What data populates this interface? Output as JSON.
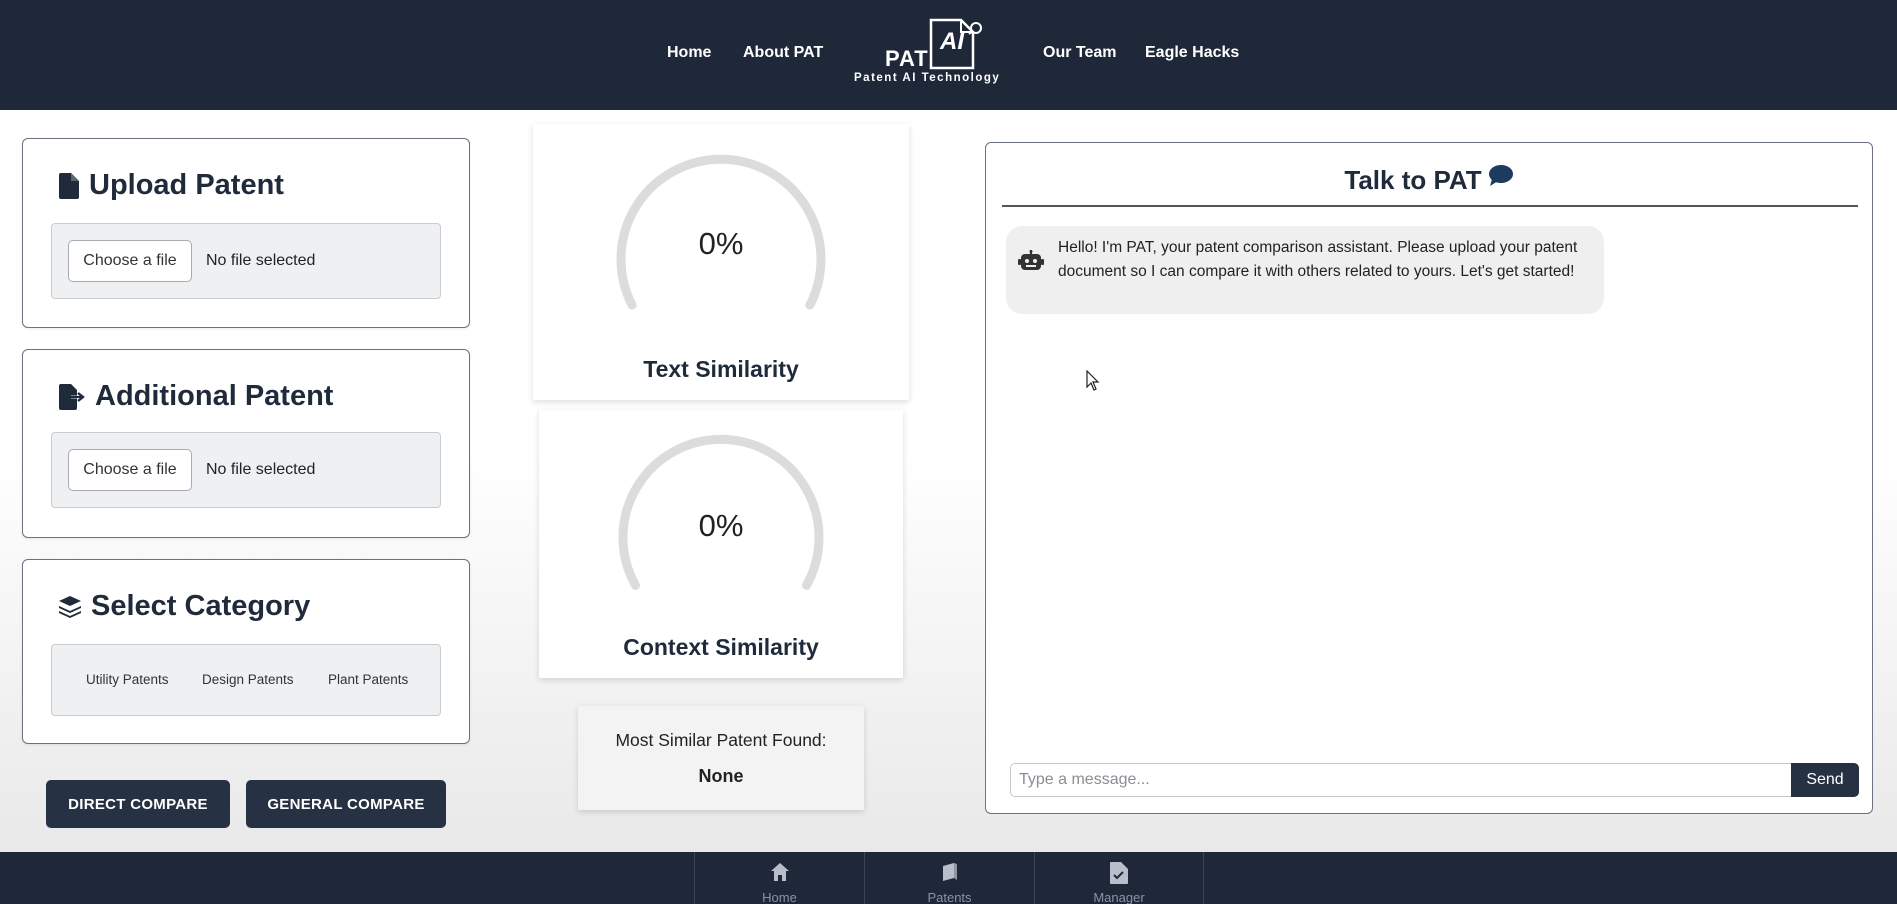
{
  "nav": {
    "links": [
      "Home",
      "About PAT",
      "Our Team",
      "Eagle Hacks"
    ],
    "logo_text": "PAT",
    "logo_badge": "AI",
    "logo_subtitle": "Patent AI Technology",
    "bg_color": "#1f2838"
  },
  "upload": {
    "title": "Upload Patent",
    "icon": "file-icon",
    "button_label": "Choose a file",
    "status": "No file selected"
  },
  "additional": {
    "title": "Additional Patent",
    "icon": "file-export-icon",
    "button_label": "Choose a file",
    "status": "No file selected"
  },
  "category": {
    "title": "Select Category",
    "icon": "layers-icon",
    "options": [
      "Utility Patents",
      "Design Patents",
      "Plant Patents"
    ]
  },
  "actions": {
    "direct": "DIRECT COMPARE",
    "general": "GENERAL COMPARE"
  },
  "gauges": {
    "text": {
      "value": "0%",
      "percent": 0,
      "label": "Text Similarity"
    },
    "context": {
      "value": "0%",
      "percent": 0,
      "label": "Context Similarity"
    }
  },
  "similar": {
    "label": "Most Similar Patent Found:",
    "value": "None"
  },
  "chat": {
    "title": "Talk to PAT",
    "title_icon": "chat-bubble-icon",
    "messages": [
      {
        "sender_icon": "robot-icon",
        "text": "Hello! I'm PAT, your patent comparison assistant. Please upload your patent document so I can compare it with others related to yours. Let's get started!"
      }
    ],
    "input_placeholder": "Type a message...",
    "send_label": "Send"
  },
  "bottom_nav": [
    {
      "label": "Home",
      "icon": "home-icon"
    },
    {
      "label": "Patents",
      "icon": "book-icon"
    },
    {
      "label": "Manager",
      "icon": "file-check-icon"
    }
  ],
  "colors": {
    "primary": "#263244",
    "accent": "#1f3a5f",
    "gauge_track": "#dcdcdc"
  }
}
